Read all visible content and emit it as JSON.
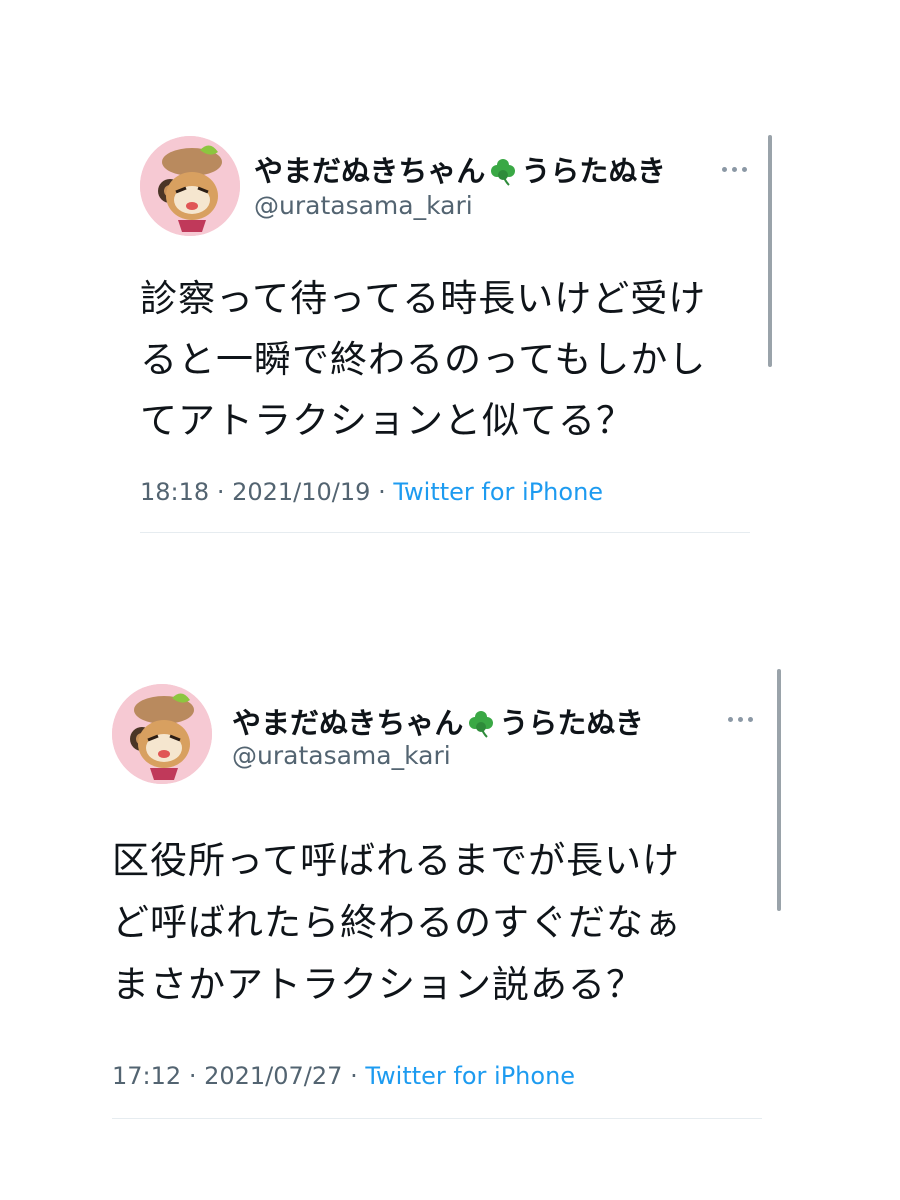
{
  "tweets": [
    {
      "display_name": "やまだぬきちゃん",
      "display_name_suffix": "うらたぬき",
      "name_emoji": "clover-icon",
      "handle": "@uratasama_kari",
      "text_lines": [
        "診察って待ってる時長いけど受け",
        "ると一瞬で終わるのってもしかし",
        "てアトラクションと似てる？"
      ],
      "time": "18:18",
      "date": "2021/10/19",
      "separator": "·",
      "source": "Twitter for iPhone"
    },
    {
      "display_name": "やまだぬきちゃん",
      "display_name_suffix": "うらたぬき",
      "name_emoji": "clover-icon",
      "handle": "@uratasama_kari",
      "text_lines": [
        "区役所って呼ばれるまでが長いけ",
        "ど呼ばれたら終わるのすぐだなぁ",
        "まさかアトラクション説ある？"
      ],
      "time": "17:12",
      "date": "2021/07/27",
      "separator": "·",
      "source": "Twitter for iPhone"
    }
  ],
  "colors": {
    "text": "#0f1419",
    "secondary": "#536471",
    "link": "#1d9bf0",
    "divider": "#e6ecf0",
    "scrollbar": "#9aa3aa",
    "avatar_bg": "#f6c9d3",
    "clover": "#3aa845"
  }
}
